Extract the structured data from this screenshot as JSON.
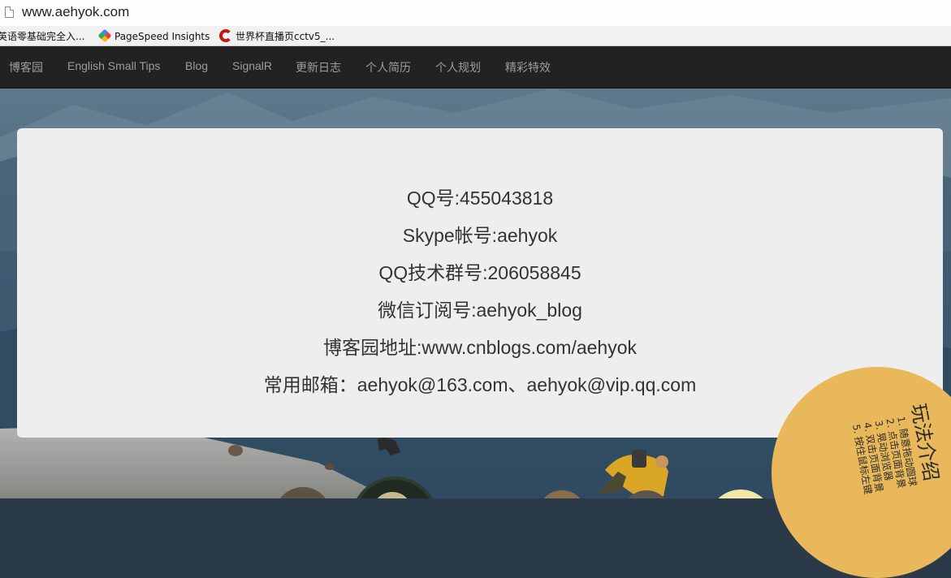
{
  "browser": {
    "url": "www.aehyok.com",
    "bookmarks": [
      {
        "label": "英语零基础完全入..."
      },
      {
        "label": "PageSpeed Insights"
      },
      {
        "label": "世界杯直播页cctv5_..."
      }
    ]
  },
  "nav": {
    "items": [
      {
        "label": "博客园"
      },
      {
        "label": "English Small Tips"
      },
      {
        "label": "Blog"
      },
      {
        "label": "SignalR"
      },
      {
        "label": "更新日志"
      },
      {
        "label": "个人简历"
      },
      {
        "label": "个人规划"
      },
      {
        "label": "精彩特效"
      }
    ]
  },
  "contact": {
    "lines": [
      "QQ号:455043818",
      "Skype帐号:aehyok",
      "QQ技术群号:206058845",
      "微信订阅号:aehyok_blog",
      "博客园地址:www.cnblogs.com/aehyok",
      "常用邮箱：aehyok@163.com、aehyok@vip.qq.com"
    ]
  },
  "play_guide": {
    "title": "玩法介绍",
    "items": [
      "1. 随意拖动圆球",
      "2. 点击页面背景",
      "3. 晃动浏览器",
      "4. 双击页面背景",
      "5. 按住鼠标左键"
    ]
  },
  "colors": {
    "nav_bg": "#222222",
    "card_bg": "#eeeeee",
    "circle": "#e8b85a"
  }
}
